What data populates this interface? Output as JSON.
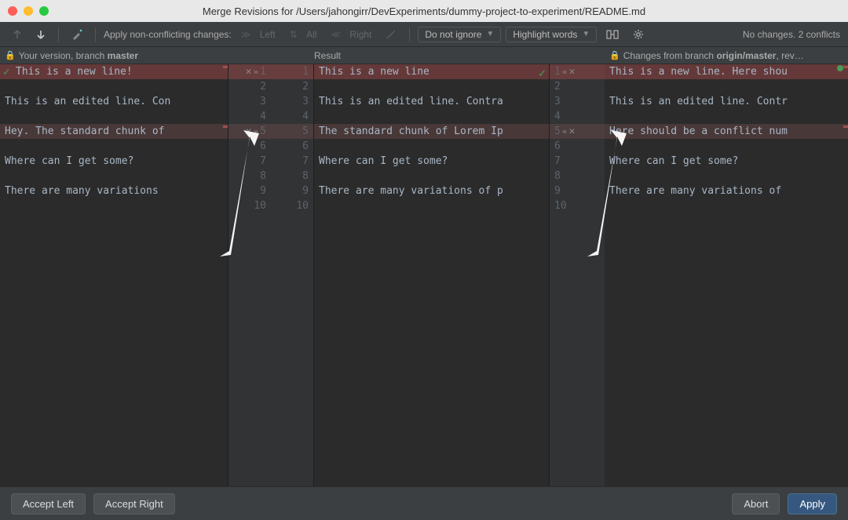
{
  "window": {
    "title": "Merge Revisions for /Users/jahongirr/DevExperiments/dummy-project-to-experiment/README.md"
  },
  "toolbar": {
    "apply_label": "Apply non-conflicting changes:",
    "left": "Left",
    "all": "All",
    "right": "Right",
    "ignore_dropdown": "Do not ignore",
    "highlight_dropdown": "Highlight words",
    "status": "No changes. 2 conflicts"
  },
  "headers": {
    "left": "Your version, branch ",
    "left_branch": "master",
    "result": "Result",
    "right": "Changes from branch ",
    "right_branch": "origin/master",
    "right_suffix": ", rev…"
  },
  "left_lines": [
    "This is a new line!",
    "",
    "This is an edited line. Con",
    "",
    "Hey. The standard chunk of ",
    "",
    "Where can I get some?",
    "",
    "There are many variations "
  ],
  "result_lines": [
    "This is a new line",
    "",
    "This is an edited line. Contra",
    "",
    "The standard chunk of Lorem Ip",
    "",
    "Where can I get some?",
    "",
    "There are many variations of p"
  ],
  "right_lines": [
    "This is a new line. Here shou",
    "",
    "This is an edited line. Contr",
    "",
    "Here should be a conflict num",
    "",
    "Where can I get some?",
    "",
    "There are many variations of "
  ],
  "gutter": {
    "left_nums": [
      "1",
      "2",
      "3",
      "4",
      "5",
      "6",
      "7",
      "8",
      "9",
      "10"
    ],
    "result_nums": [
      "1",
      "2",
      "3",
      "4",
      "5",
      "6",
      "7",
      "8",
      "9",
      "10"
    ],
    "right_nums": [
      "1",
      "2",
      "3",
      "4",
      "5",
      "6",
      "7",
      "8",
      "9",
      "10"
    ]
  },
  "footer": {
    "accept_left": "Accept Left",
    "accept_right": "Accept Right",
    "abort": "Abort",
    "apply": "Apply"
  }
}
